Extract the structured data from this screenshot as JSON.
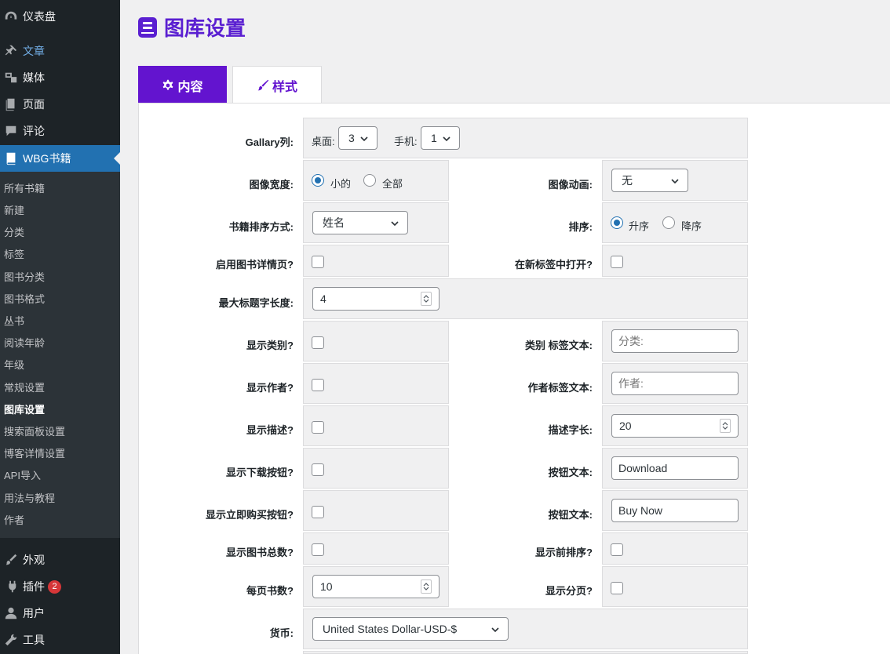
{
  "sidebar": {
    "top_items": [
      {
        "label": "仪表盘",
        "icon": "dashboard-icon"
      },
      {
        "label": "文章",
        "icon": "pin-icon"
      },
      {
        "label": "媒体",
        "icon": "media-icon"
      },
      {
        "label": "页面",
        "icon": "page-icon"
      },
      {
        "label": "评论",
        "icon": "comment-icon"
      },
      {
        "label": "WBG书籍",
        "icon": "book-icon"
      }
    ],
    "sub_items": [
      "所有书籍",
      "新建",
      "分类",
      "标签",
      "图书分类",
      "图书格式",
      "丛书",
      "阅读年龄",
      "年级",
      "常规设置",
      "图库设置",
      "搜索面板设置",
      "博客详情设置",
      "API导入",
      "用法与教程",
      "作者"
    ],
    "bottom_items": [
      {
        "label": "外观",
        "icon": "brush-icon"
      },
      {
        "label": "插件",
        "icon": "plugin-icon",
        "badge": "2"
      },
      {
        "label": "用户",
        "icon": "user-icon"
      },
      {
        "label": "工具",
        "icon": "wrench-icon"
      }
    ]
  },
  "header": {
    "title": "图库设置"
  },
  "tabs": [
    {
      "label": "内容",
      "icon": "gear-icon"
    },
    {
      "label": "样式",
      "icon": "brush-icon"
    }
  ],
  "form": {
    "gallery_cols": {
      "label": "Gallary列:",
      "desktop_label": "桌面:",
      "desktop_value": "3",
      "mobile_label": "手机:",
      "mobile_value": "1"
    },
    "image_width": {
      "label": "图像宽度:",
      "option1": "小的",
      "option2": "全部",
      "selected": "小的"
    },
    "image_anim": {
      "label": "图像动画:",
      "value": "无"
    },
    "sort_by": {
      "label": "书籍排序方式:",
      "value": "姓名"
    },
    "order": {
      "label": "排序:",
      "option1": "升序",
      "option2": "降序",
      "selected": "升序"
    },
    "enable_detail": {
      "label": "启用图书详情页?"
    },
    "open_new_tab": {
      "label": "在新标签中打开?"
    },
    "max_title": {
      "label": "最大标题字长度:",
      "value": "4"
    },
    "show_category": {
      "label": "显示类别?"
    },
    "category_text": {
      "label": "类别 标签文本:",
      "placeholder": "分类:"
    },
    "show_author": {
      "label": "显示作者?"
    },
    "author_text": {
      "label": "作者标签文本:",
      "placeholder": "作者:"
    },
    "show_desc": {
      "label": "显示描述?"
    },
    "desc_len": {
      "label": "描述字长:",
      "value": "20"
    },
    "show_download": {
      "label": "显示下载按钮?"
    },
    "download_text": {
      "label": "按钮文本:",
      "value": "Download"
    },
    "show_buynow": {
      "label": "显示立即购买按钮?"
    },
    "buynow_text": {
      "label": "按钮文本:",
      "value": "Buy Now"
    },
    "show_total": {
      "label": "显示图书总数?"
    },
    "show_sort": {
      "label": "显示前排序?"
    },
    "per_page": {
      "label": "每页书数?",
      "value": "10"
    },
    "show_pagination": {
      "label": "显示分页?"
    },
    "currency": {
      "label": "货币:",
      "value": "United States Dollar-USD-$"
    }
  },
  "colors": {
    "accent": "#6314cf",
    "sidebar_bg": "#1d2327",
    "sidebar_active": "#2271b1",
    "link": "#72aee6",
    "badge": "#d63638"
  }
}
